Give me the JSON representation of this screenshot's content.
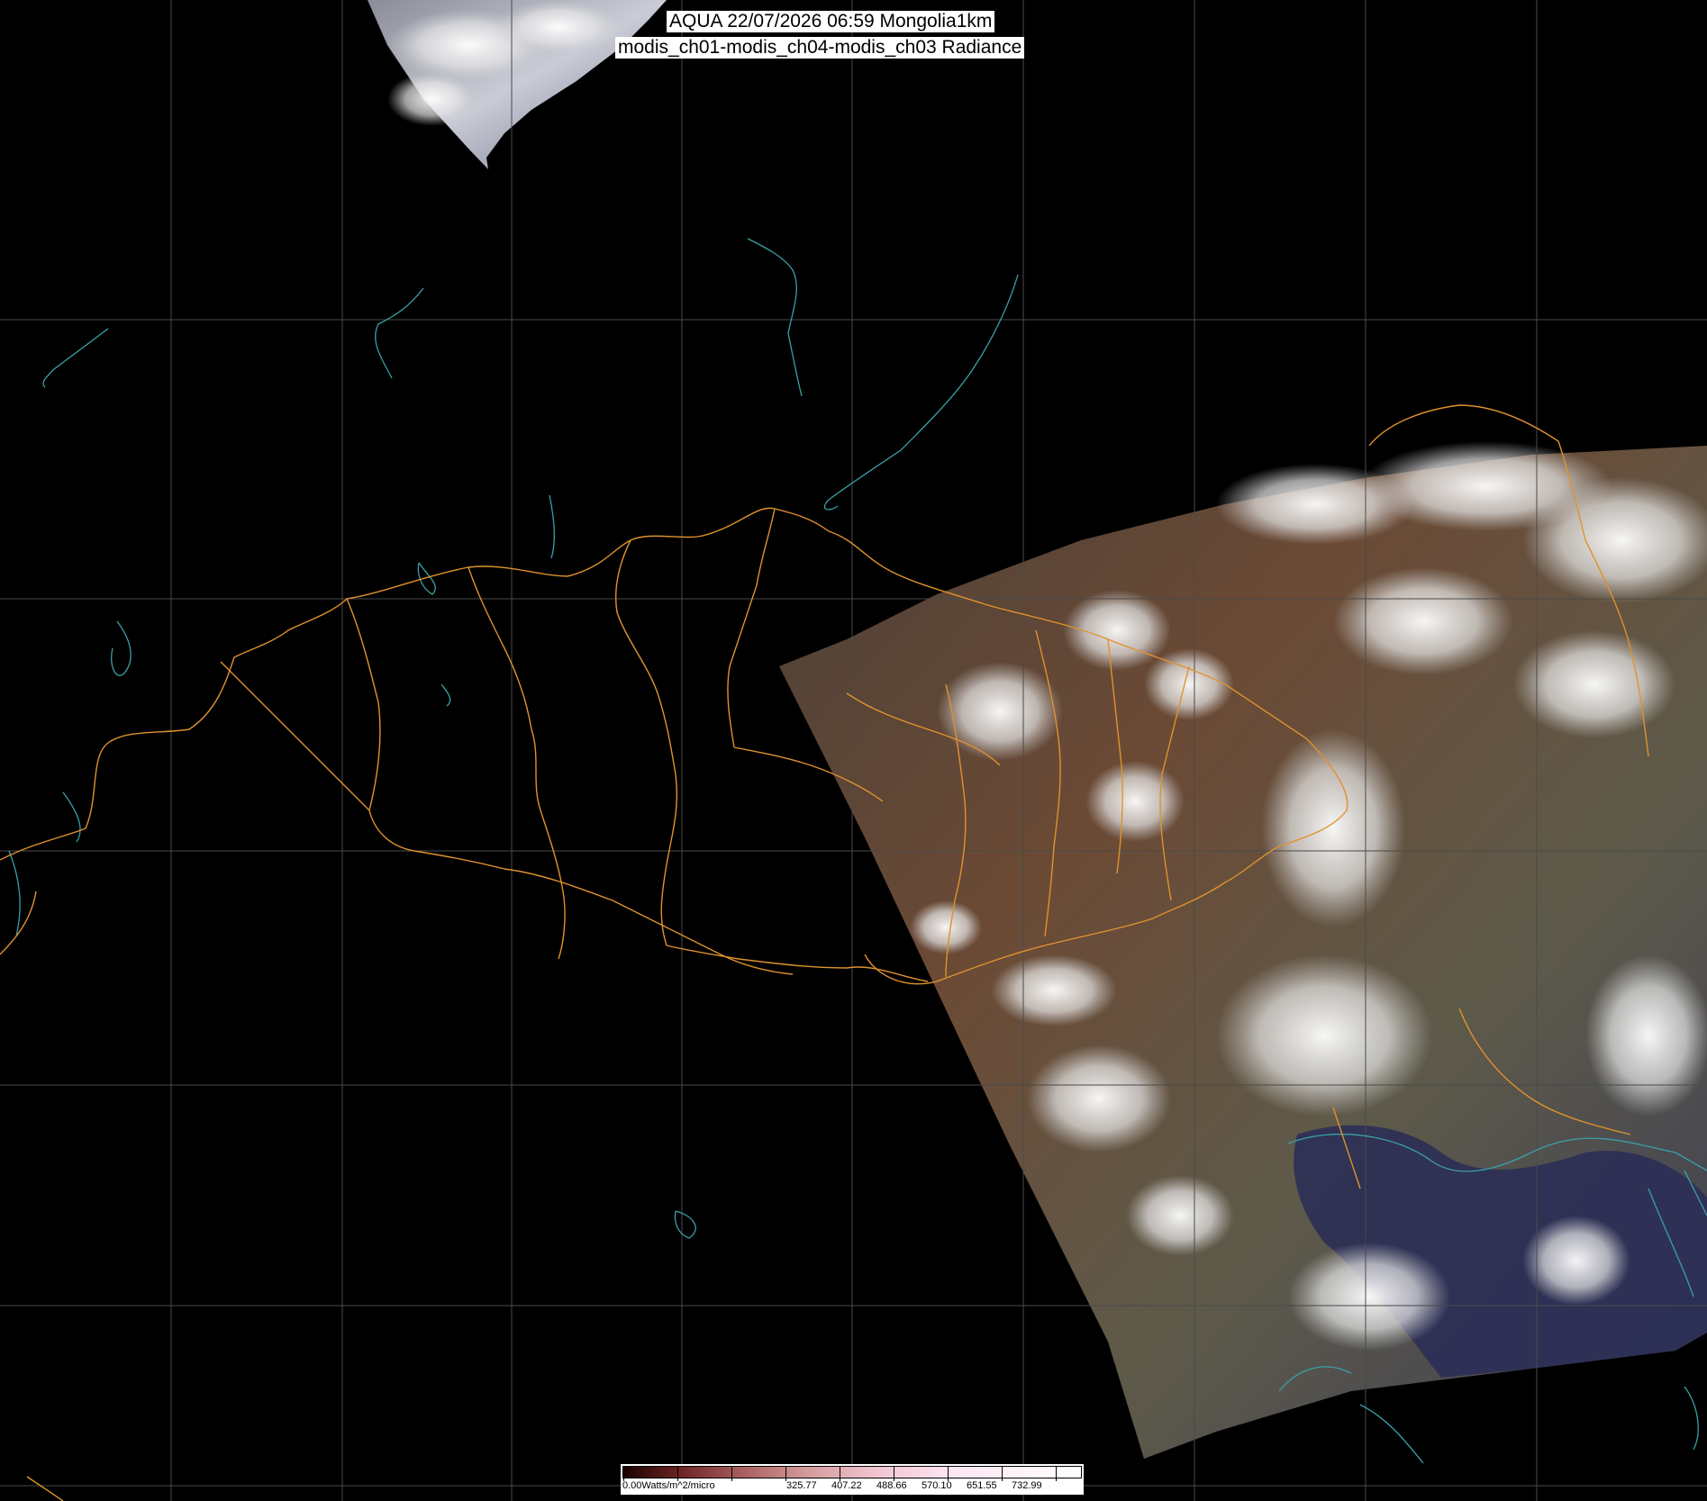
{
  "header": {
    "line1": "AQUA 22/07/2026 06:59 Mongolia1km",
    "line2": "modis_ch01-modis_ch04-modis_ch03 Radiance"
  },
  "colorbar": {
    "unit_label": "0.00Watts/m^2/micro",
    "tick_values": [
      "325.77",
      "407.22",
      "488.66",
      "570.10",
      "651.55",
      "732.99"
    ],
    "colors": [
      "#1a0000",
      "#6b2222",
      "#d49a9a",
      "#f0c4d0",
      "#ffffff"
    ]
  },
  "map": {
    "colors": {
      "background": "#000000",
      "graticule": "#4a4a4a",
      "boundaries": "#e0922e",
      "coastlines": "#3aa0a8",
      "land": "#6b4a35",
      "cloud": "#eeeeee",
      "sea": "#2b2f55"
    }
  }
}
